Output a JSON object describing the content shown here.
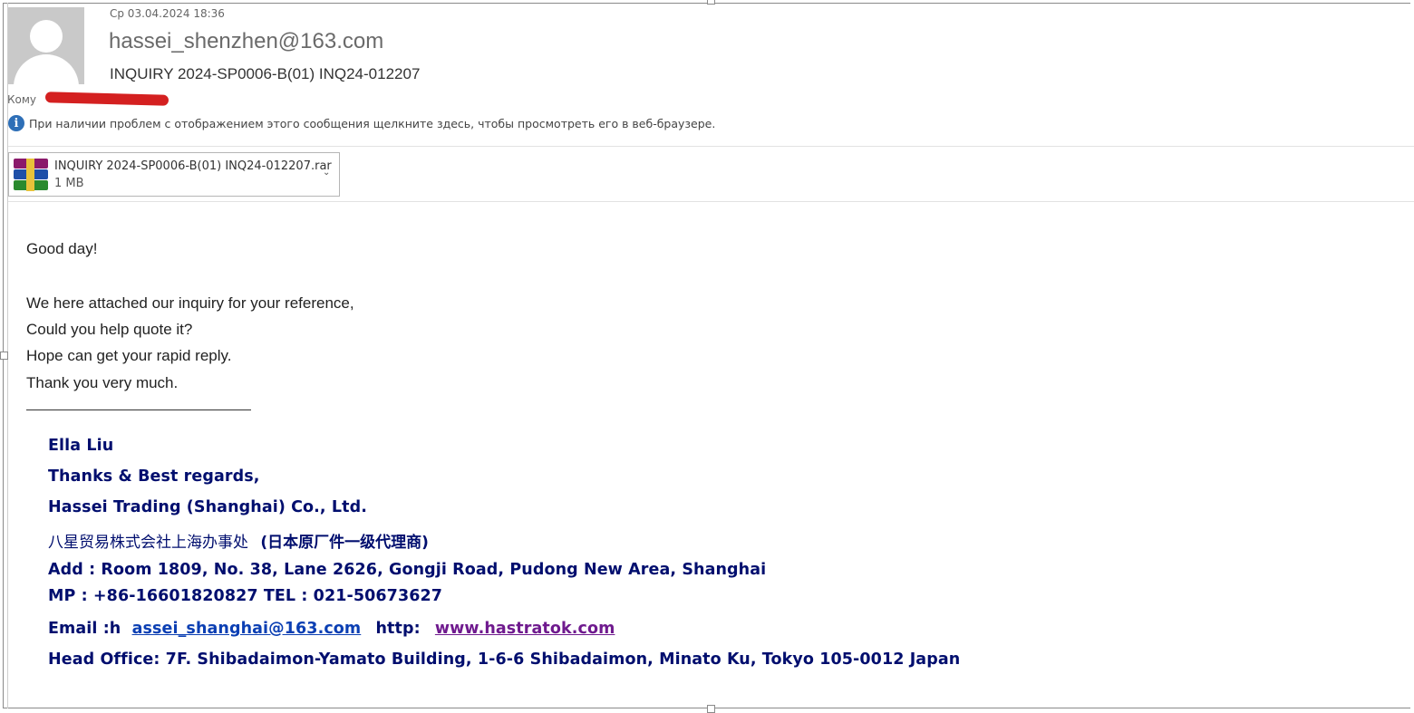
{
  "header": {
    "date": "Ср 03.04.2024 18:36",
    "sender": "hassei_shenzhen@163.com",
    "subject": "INQUIRY 2024-SP0006-B(01) INQ24-012207",
    "to_label": "Кому"
  },
  "info_bar": {
    "icon": "info-icon",
    "text": "При наличии проблем с отображением этого сообщения щелкните здесь, чтобы просмотреть его в веб-браузере."
  },
  "attachment": {
    "icon": "winrar-archive-icon",
    "filename": "INQUIRY 2024-SP0006-B(01) INQ24-012207.rar",
    "size": "1 MB",
    "caret": "⌄"
  },
  "message": {
    "greeting": "Good day!",
    "lines": [
      "We here attached our inquiry for your reference,",
      "Could you help quote it?",
      "Hope can get your rapid reply.",
      "Thank you very much."
    ]
  },
  "signature": {
    "name": "Ella Liu",
    "regards": "Thanks & Best regards,",
    "company": "Hassei Trading (Shanghai) Co., Ltd.",
    "company_cn": "八星贸易株式会社上海办事处",
    "company_cn_note": "(日本原厂件一级代理商)",
    "address": "Add : Room 1809, No. 38, Lane 2626, Gongji Road, Pudong New Area, Shanghai",
    "phones": "MP : +86-16601820827 TEL : 021-50673627",
    "email_label": "Email :h",
    "email": "assei_shanghai@163.com",
    "http_label": "http:",
    "website": "www.hastratok.com",
    "head_office": "Head Office: 7F. Shibadaimon-Yamato Building, 1-6-6 Shibadaimon, Minato Ku, Tokyo 105-0012 Japan"
  },
  "colors": {
    "signature": "#000e6e",
    "email_link": "#0b3fb3",
    "website_link": "#6f1a8e",
    "redaction": "#d42020",
    "info_icon": "#2e6fb7"
  }
}
